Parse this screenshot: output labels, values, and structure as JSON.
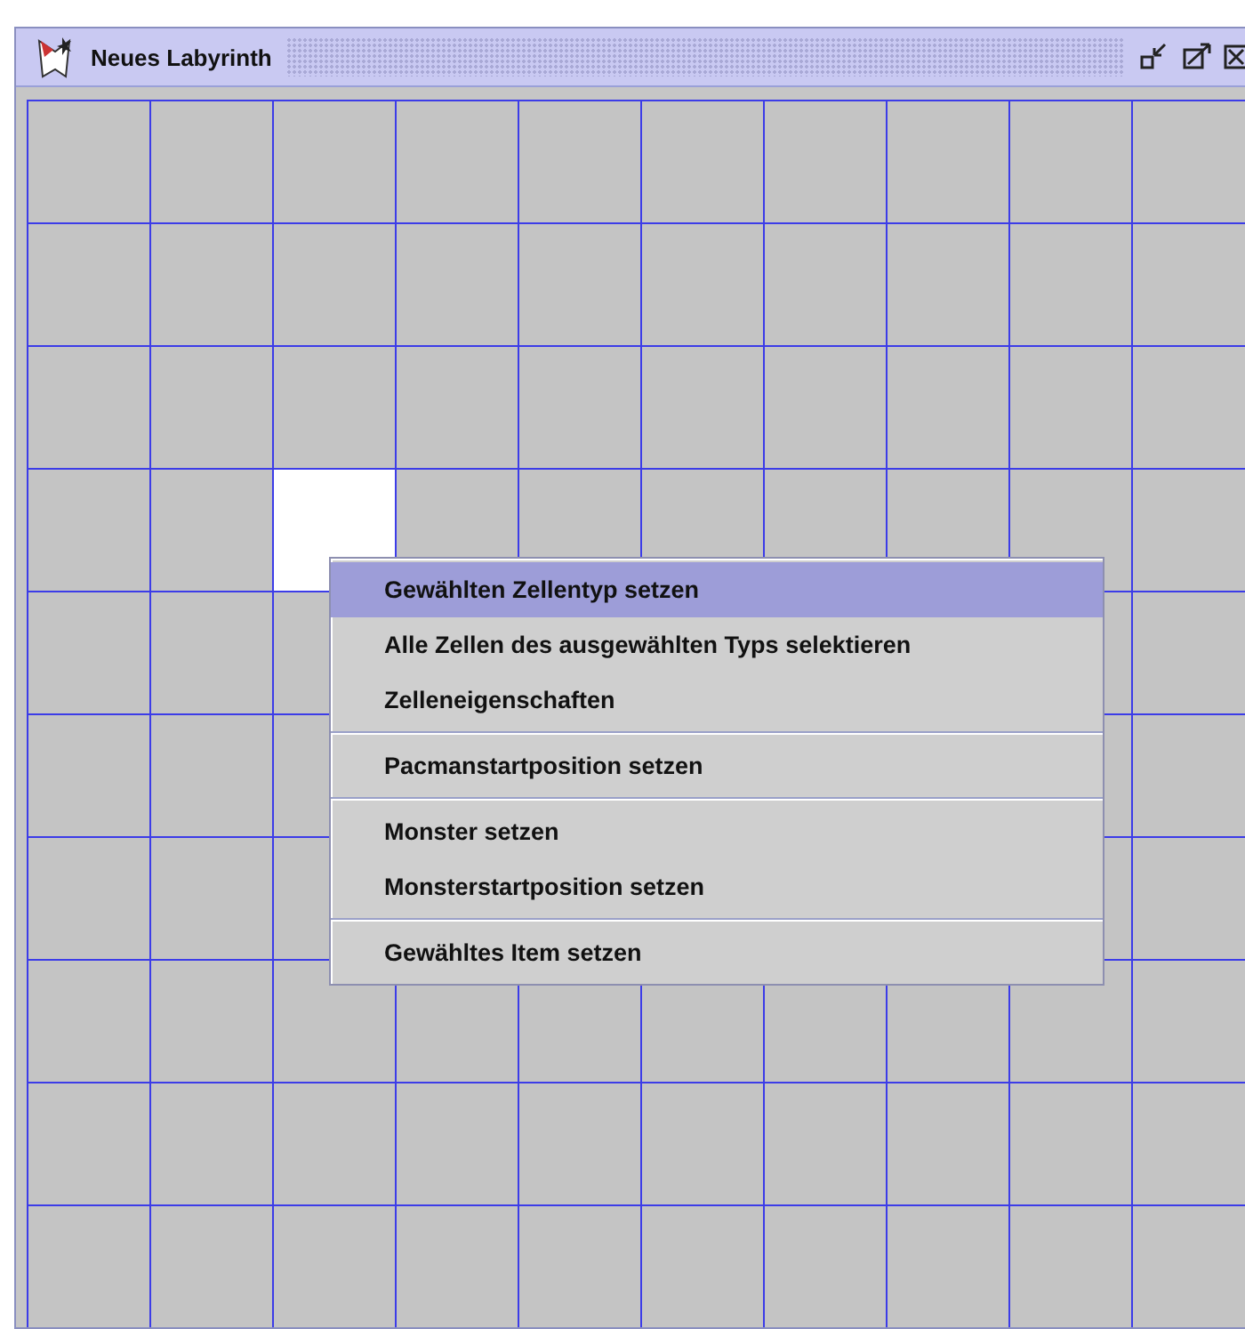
{
  "window": {
    "title": "Neues Labyrinth"
  },
  "grid": {
    "rows": [
      [
        {
          "selected": false
        },
        {
          "selected": false
        },
        {
          "selected": false
        },
        {
          "selected": false
        },
        {
          "selected": false
        },
        {
          "selected": false
        },
        {
          "selected": false
        },
        {
          "selected": false
        },
        {
          "selected": false
        },
        {
          "selected": false
        }
      ],
      [
        {
          "selected": false
        },
        {
          "selected": false
        },
        {
          "selected": false
        },
        {
          "selected": false
        },
        {
          "selected": false
        },
        {
          "selected": false
        },
        {
          "selected": false
        },
        {
          "selected": false
        },
        {
          "selected": false
        },
        {
          "selected": false
        }
      ],
      [
        {
          "selected": false
        },
        {
          "selected": false
        },
        {
          "selected": false
        },
        {
          "selected": false
        },
        {
          "selected": false
        },
        {
          "selected": false
        },
        {
          "selected": false
        },
        {
          "selected": false
        },
        {
          "selected": false
        },
        {
          "selected": false
        }
      ],
      [
        {
          "selected": false
        },
        {
          "selected": false
        },
        {
          "selected": true
        },
        {
          "selected": false
        },
        {
          "selected": false
        },
        {
          "selected": false
        },
        {
          "selected": false
        },
        {
          "selected": false
        },
        {
          "selected": false
        },
        {
          "selected": false
        }
      ],
      [
        {
          "selected": false
        },
        {
          "selected": false
        },
        {
          "selected": false
        },
        {},
        {},
        {},
        {},
        {},
        {
          "selected": false
        },
        {
          "selected": false
        }
      ],
      [
        {
          "selected": false
        },
        {
          "selected": false
        },
        {
          "selected": false
        },
        {},
        {},
        {},
        {},
        {},
        {
          "selected": false
        },
        {
          "selected": false
        }
      ],
      [
        {
          "selected": false
        },
        {
          "selected": false
        },
        {
          "selected": false
        },
        {},
        {},
        {},
        {},
        {},
        {
          "selected": false
        },
        {
          "selected": false
        }
      ],
      [
        {
          "selected": false
        },
        {
          "selected": false
        },
        {
          "selected": false
        },
        {
          "selected": false
        },
        {
          "selected": false
        },
        {
          "selected": false
        },
        {
          "selected": false
        },
        {
          "selected": false
        },
        {
          "selected": false
        },
        {
          "selected": false
        }
      ],
      [
        {
          "selected": false
        },
        {
          "selected": false
        },
        {
          "selected": false
        },
        {
          "selected": false
        },
        {
          "selected": false
        },
        {
          "selected": false
        },
        {
          "selected": false
        },
        {
          "selected": false
        },
        {
          "selected": false
        },
        {
          "selected": false
        }
      ],
      [
        {
          "selected": false
        },
        {
          "selected": false
        },
        {
          "selected": false
        },
        {
          "selected": false
        },
        {
          "selected": false
        },
        {
          "selected": false
        },
        {
          "selected": false
        },
        {
          "selected": false
        },
        {
          "selected": false
        },
        {
          "selected": false
        }
      ]
    ]
  },
  "context_menu": {
    "groups": [
      [
        {
          "label": "Gewählten Zellentyp setzen",
          "selected": true
        },
        {
          "label": "Alle Zellen des ausgewählten Typs selektieren",
          "selected": false
        },
        {
          "label": "Zelleneigenschaften",
          "selected": false
        }
      ],
      [
        {
          "label": "Pacmanstartposition setzen",
          "selected": false
        }
      ],
      [
        {
          "label": "Monster setzen",
          "selected": false
        },
        {
          "label": "Monsterstartposition setzen",
          "selected": false
        }
      ],
      [
        {
          "label": "Gewähltes Item setzen",
          "selected": false
        }
      ]
    ]
  }
}
